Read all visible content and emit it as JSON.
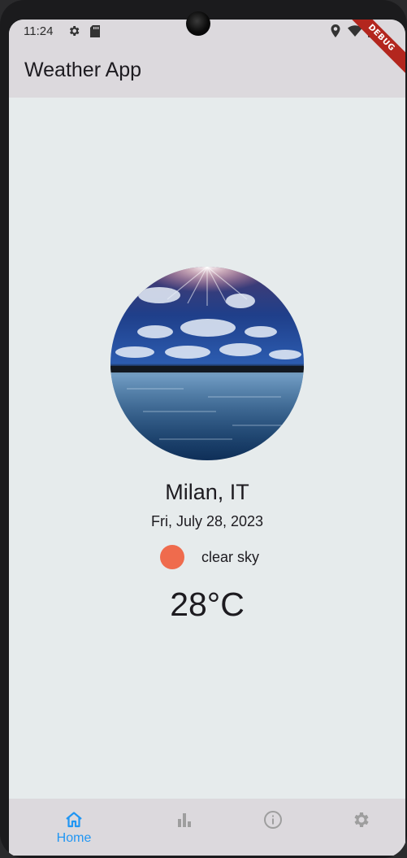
{
  "status_bar": {
    "time": "11:24",
    "icons": [
      "gear-icon",
      "sd-card-icon",
      "location-icon",
      "wifi-icon",
      "battery-icon"
    ]
  },
  "app_bar": {
    "title": "Weather App",
    "debug_banner": "DEBUG"
  },
  "weather": {
    "image": "sky-over-lake-photo",
    "city": "Milan, IT",
    "date": "Fri, July 28, 2023",
    "condition": "clear sky",
    "condition_color": "#ef6b4d",
    "temperature": "28°C"
  },
  "bottom_nav": {
    "active_color": "#2196f3",
    "inactive_color": "#9e9e9e",
    "items": [
      {
        "icon": "home-icon",
        "label": "Home",
        "active": true
      },
      {
        "icon": "bar-chart-icon",
        "label": "",
        "active": false
      },
      {
        "icon": "info-icon",
        "label": "",
        "active": false
      },
      {
        "icon": "settings-icon",
        "label": "",
        "active": false
      }
    ]
  }
}
